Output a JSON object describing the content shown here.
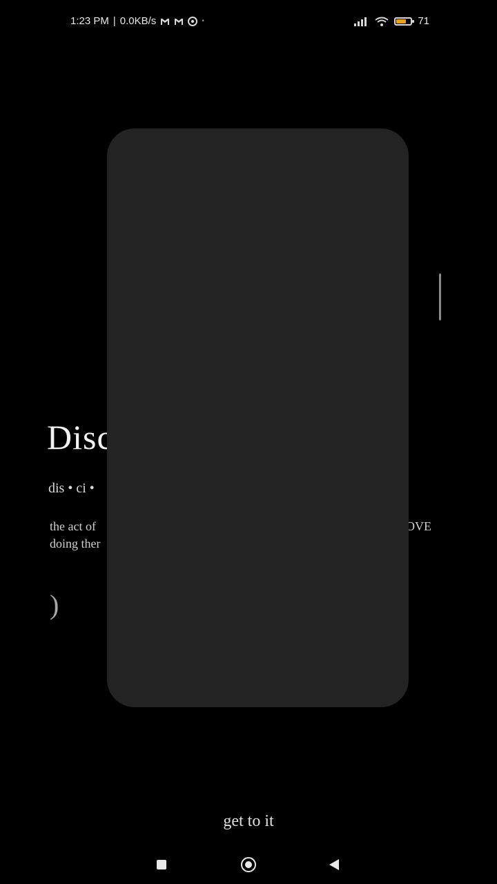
{
  "status_bar": {
    "time": "1:23 PM",
    "separator": "|",
    "network_speed": "0.0KB/s",
    "battery_percent": "71",
    "battery_level": 0.71,
    "icons": [
      "gmail-icon",
      "gmail-icon",
      "whatsapp-icon",
      "signal-icon",
      "wifi-icon",
      "battery-icon"
    ]
  },
  "background": {
    "headword": "Disc",
    "pronunciation": "dis • ci •",
    "definition_line1_left": "the act of",
    "definition_line1_right": "OVE",
    "definition_line2_left": "doing ther",
    "paren": ")"
  },
  "actions": {
    "get_to_it": "get to it"
  },
  "nav": {
    "recents": "recents-icon",
    "home": "home-icon",
    "back": "back-icon"
  },
  "colors": {
    "background": "#000000",
    "card": "#232323",
    "battery_fill": "#e6a21f",
    "text": "#e0e0e0"
  }
}
